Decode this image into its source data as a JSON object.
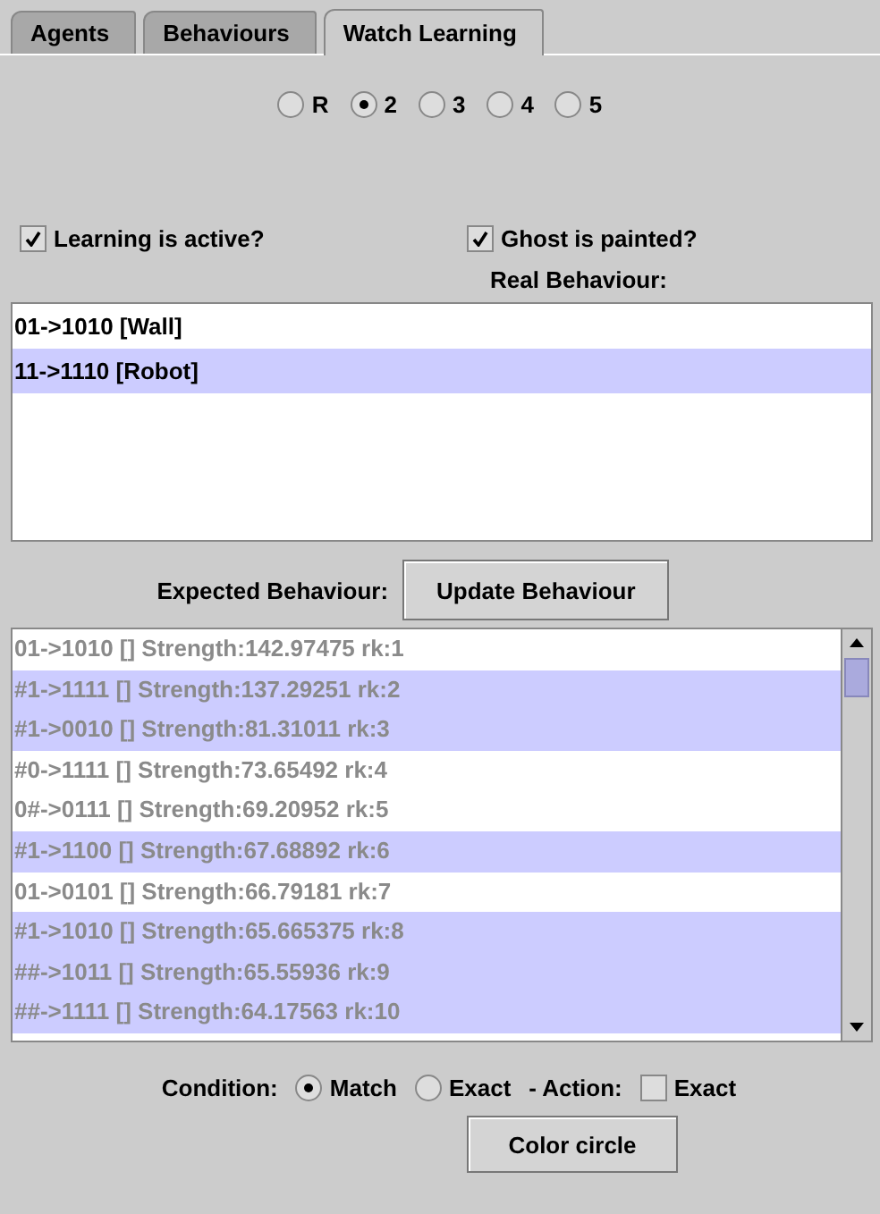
{
  "tabs": [
    {
      "label": "Agents",
      "selected": false
    },
    {
      "label": "Behaviours",
      "selected": false
    },
    {
      "label": "Watch Learning",
      "selected": true
    }
  ],
  "agent_choice": [
    {
      "label": "R",
      "selected": false
    },
    {
      "label": "2",
      "selected": true
    },
    {
      "label": "3",
      "selected": false
    },
    {
      "label": "4",
      "selected": false
    },
    {
      "label": "5",
      "selected": false
    }
  ],
  "options": [
    {
      "label": "Learning is active?",
      "checked": true
    },
    {
      "label": "Ghost is painted?",
      "checked": true
    }
  ],
  "real_behaviour": {
    "label": "Real Behaviour:",
    "rows": [
      {
        "text": "01->1010 [Wall]",
        "selected": false
      },
      {
        "text": "11->1110 [Robot]",
        "selected": true
      }
    ]
  },
  "expected_behaviour": {
    "label": "Expected Behaviour:",
    "button": "Update Behaviour",
    "disabled": true,
    "rows": [
      {
        "text": "01->1010 [] Strength:142.97475  rk:1",
        "selected": false
      },
      {
        "text": "#1->1111 [] Strength:137.29251  rk:2",
        "selected": true
      },
      {
        "text": "#1->0010 [] Strength:81.31011  rk:3",
        "selected": true
      },
      {
        "text": "#0->1111 [] Strength:73.65492  rk:4",
        "selected": false
      },
      {
        "text": "0#->0111 [] Strength:69.20952  rk:5",
        "selected": false
      },
      {
        "text": "#1->1100 [] Strength:67.68892  rk:6",
        "selected": true
      },
      {
        "text": "01->0101 [] Strength:66.79181  rk:7",
        "selected": false
      },
      {
        "text": "#1->1010 [] Strength:65.665375  rk:8",
        "selected": true
      },
      {
        "text": "##->1011 [] Strength:65.55936  rk:9",
        "selected": true
      },
      {
        "text": "##->1111 [] Strength:64.17563  rk:10",
        "selected": true
      }
    ]
  },
  "filter": {
    "condition_label": "Condition:",
    "condition": [
      {
        "label": "Match",
        "selected": true
      },
      {
        "label": "Exact",
        "selected": false
      }
    ],
    "action_label": "- Action:",
    "action_exact": {
      "label": "Exact",
      "checked": false
    }
  },
  "color_button": "Color circle"
}
